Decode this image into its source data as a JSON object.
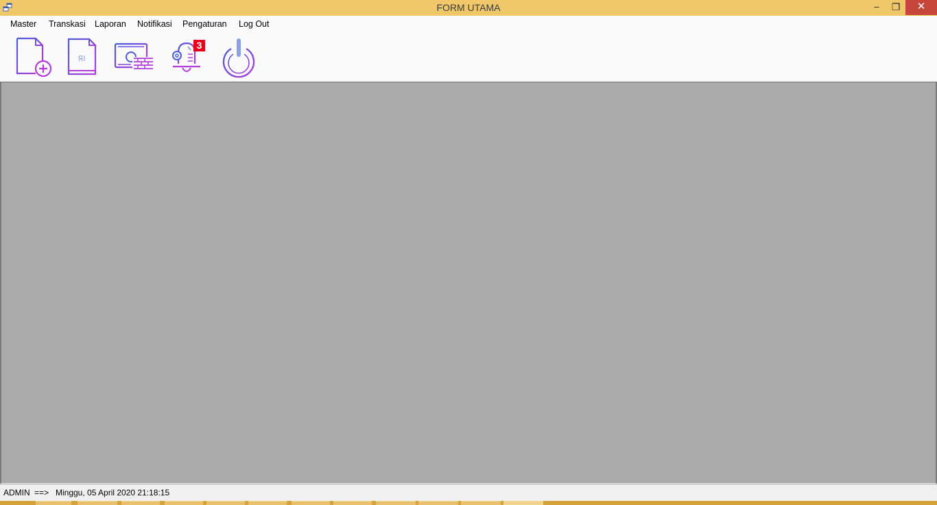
{
  "window": {
    "title": "FORM UTAMA",
    "minimize_glyph": "−",
    "maximize_glyph": "❐",
    "close_glyph": "✕"
  },
  "menu": {
    "items": [
      {
        "label": "Master"
      },
      {
        "label": "Transkasi"
      },
      {
        "label": "Laporan"
      },
      {
        "label": "Notifikasi"
      },
      {
        "label": "Pengaturan"
      },
      {
        "label": "Log Out"
      }
    ]
  },
  "toolbar": {
    "icons": [
      "new-document-icon",
      "report-document-icon",
      "money-icon",
      "notification-bell-icon",
      "power-icon"
    ],
    "notification_count": "3"
  },
  "status": {
    "user": "ADMIN",
    "arrow": "==>",
    "datetime": "Minggu, 05 April 2020 21:18:15"
  },
  "colors": {
    "titlebar": "#f0c86a",
    "close_button": "#c7463c",
    "mdi_background": "#ababab",
    "icon_blue": "#4a5cd8",
    "icon_purple": "#b23adf",
    "badge": "#e8001c"
  }
}
